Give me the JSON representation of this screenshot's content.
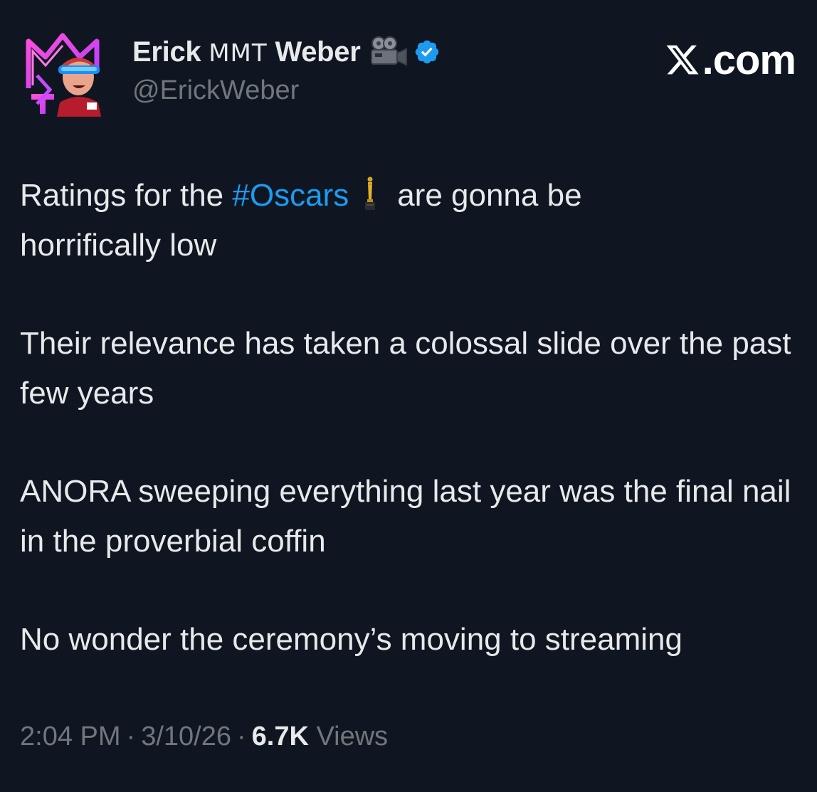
{
  "tweet": {
    "author": {
      "name": "Erick",
      "name_styled": "MMT",
      "name_last": "Weber",
      "handle": "@ErickWeber",
      "name_emoji_icon": "movie-camera-icon",
      "verified_icon": "verified-badge-icon"
    },
    "source_label": ".com",
    "source_icon": "x-logo-icon",
    "paragraphs": {
      "p1_before": "Ratings for the ",
      "p1_hashtag": "#Oscars",
      "p1_icon": "oscar-trophy-icon",
      "p1_after_line1": "are gonna be",
      "p1_line2": "horrifically low",
      "p2": "Their relevance has taken a colossal slide over the past few years",
      "p3": "ANORA sweeping everything last year was the final nail in the proverbial coffin",
      "p4": "No wonder the ceremony’s moving to streaming"
    },
    "meta": {
      "time": "2:04 PM",
      "date": "3/10/26",
      "views_count": "6.7K",
      "views_label": "Views",
      "separator": "·"
    }
  },
  "colors": {
    "background": "#0f1621",
    "text": "#e7e9ea",
    "muted": "#71767b",
    "link": "#1d9bf0",
    "verified": "#1d9bf0"
  }
}
